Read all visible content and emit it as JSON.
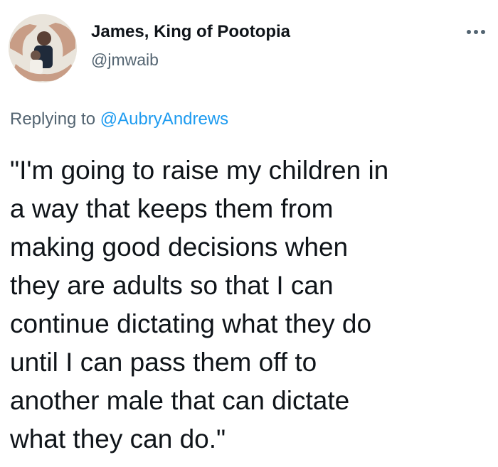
{
  "author": {
    "display_name": "James, King of Pootopia",
    "handle": "@jmwaib"
  },
  "reply_context": {
    "prefix": "Replying to",
    "mention": "@AubryAndrews"
  },
  "tweet": {
    "lines": [
      "\"I'm going to raise my children in",
      "a way that keeps them from",
      "making good decisions when",
      "they are adults so that I can",
      "continue dictating what they do",
      "until I can pass them off to",
      "another male that can dictate",
      "what they can do.\""
    ]
  },
  "icons": {
    "more": "more-options-icon",
    "avatar": "profile-photo"
  },
  "colors": {
    "text": "#0f1419",
    "secondary": "#536471",
    "link": "#1d9bf0",
    "background": "#ffffff"
  }
}
